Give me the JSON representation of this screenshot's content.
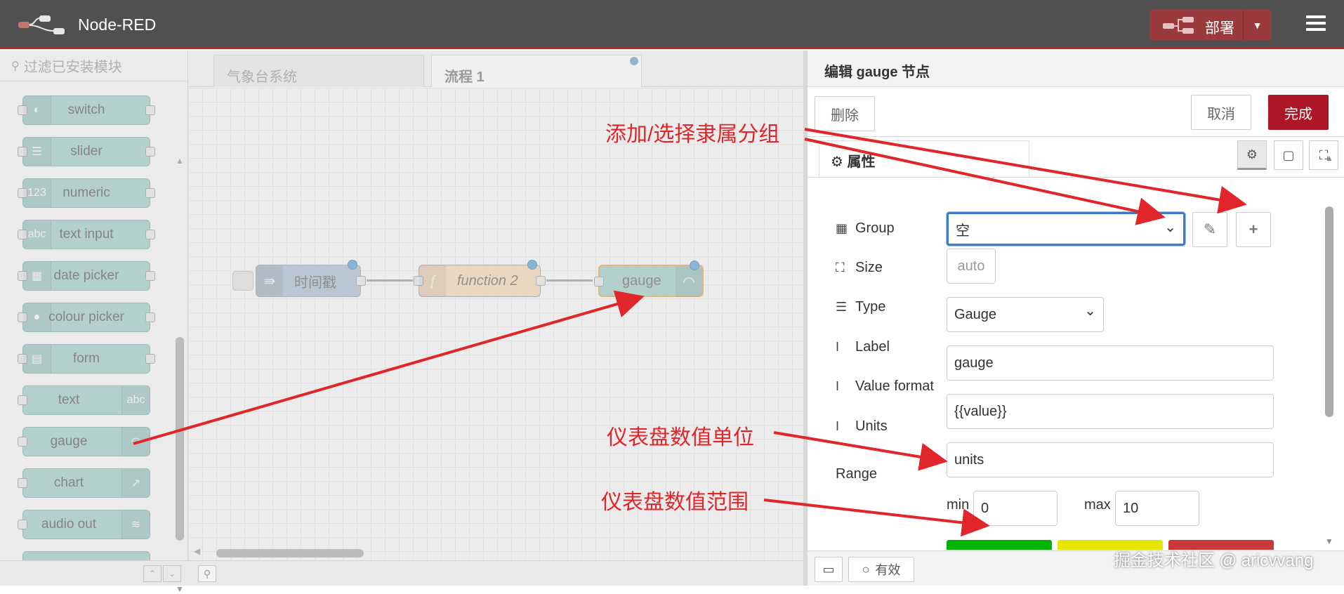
{
  "header": {
    "title": "Node-RED",
    "deploy_label": "部署"
  },
  "palette": {
    "search_placeholder": "过滤已安装模块",
    "nodes": [
      {
        "label": "switch",
        "icon": "toggle-icon"
      },
      {
        "label": "slider",
        "icon": "sliders-icon"
      },
      {
        "label": "numeric",
        "icon": "numeric-icon"
      },
      {
        "label": "text input",
        "icon": "text-input-icon"
      },
      {
        "label": "date picker",
        "icon": "calendar-icon"
      },
      {
        "label": "colour picker",
        "icon": "palette-icon"
      },
      {
        "label": "form",
        "icon": "form-icon"
      },
      {
        "label": "text",
        "icon": "text-icon"
      },
      {
        "label": "gauge",
        "icon": "gauge-icon"
      },
      {
        "label": "chart",
        "icon": "chart-icon"
      },
      {
        "label": "audio out",
        "icon": "audio-icon"
      }
    ]
  },
  "workspace": {
    "tabs": [
      {
        "label": "气象台系统"
      },
      {
        "label": "流程 1"
      }
    ],
    "flow_nodes": [
      {
        "label": "时间戳"
      },
      {
        "label": "function 2"
      },
      {
        "label": "gauge"
      }
    ]
  },
  "tray": {
    "title": "编辑 gauge 节点",
    "delete_label": "删除",
    "cancel_label": "取消",
    "done_label": "完成",
    "properties_tab": "属性",
    "fields": {
      "group_label": "Group",
      "group_value": "空",
      "size_label": "Size",
      "size_value": "auto",
      "type_label": "Type",
      "type_value": "Gauge",
      "label_label": "Label",
      "label_value": "gauge",
      "value_format_label": "Value format",
      "value_format_value": "{{value}}",
      "units_label": "Units",
      "units_value": "units",
      "range_label": "Range",
      "min_label": "min",
      "min_value": "0",
      "max_label": "max",
      "max_value": "10"
    },
    "footer": {
      "enabled_label": "有效"
    },
    "colors": [
      "#00b500",
      "#e6e600",
      "#ca3838"
    ]
  },
  "annotations": {
    "group": "添加/选择隶属分组",
    "units": "仪表盘数值单位",
    "range": "仪表盘数值范围"
  },
  "watermark": "掘金技术社区 @ aricvvang"
}
